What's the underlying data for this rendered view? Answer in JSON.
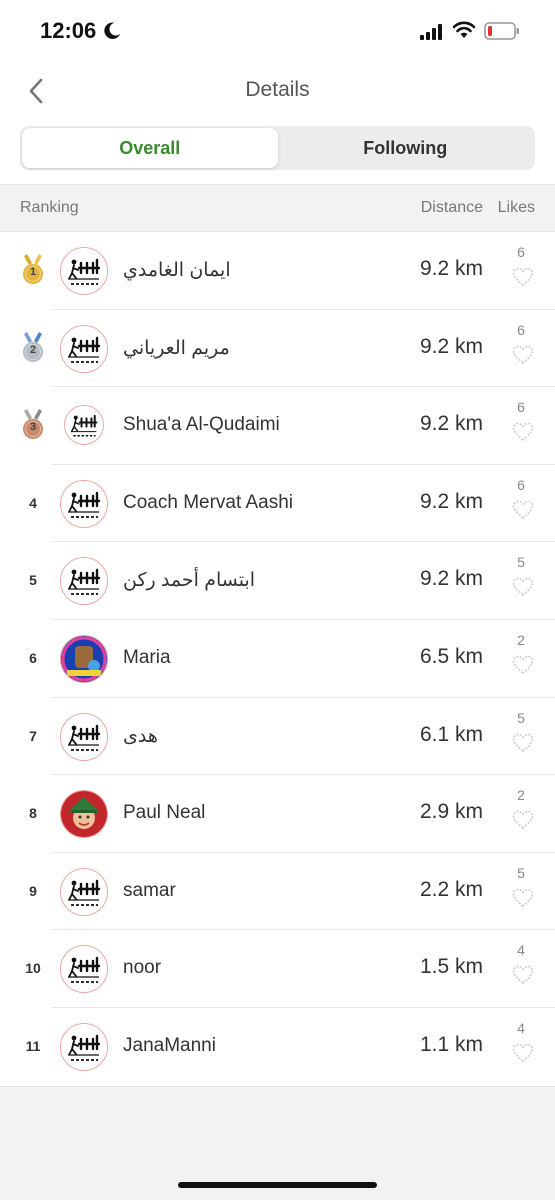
{
  "status_bar": {
    "time": "12:06"
  },
  "nav": {
    "title": "Details"
  },
  "tabs": [
    {
      "label": "Overall",
      "active": true
    },
    {
      "label": "Following",
      "active": false
    }
  ],
  "table_header": {
    "ranking": "Ranking",
    "distance": "Distance",
    "likes": "Likes"
  },
  "colors": {
    "accent_green": "#3a8a2e",
    "gold": "#e3b33a",
    "silver": "#b7bcc2",
    "bronze": "#c9896a"
  },
  "rows": [
    {
      "rank": "1",
      "medal": "gold",
      "avatar": "club-logo",
      "name": "ايمان الغامدي",
      "distance": "9.2 km",
      "likes": "6"
    },
    {
      "rank": "2",
      "medal": "silver",
      "avatar": "club-logo",
      "name": "مريم العرياني",
      "distance": "9.2 km",
      "likes": "6"
    },
    {
      "rank": "3",
      "medal": "bronze",
      "avatar": "club-logo",
      "name": "Shua'a Al-Qudaimi",
      "distance": "9.2 km",
      "likes": "6"
    },
    {
      "rank": "4",
      "avatar": "club-logo",
      "name": "Coach Mervat Aashi",
      "distance": "9.2 km",
      "likes": "6"
    },
    {
      "rank": "5",
      "avatar": "club-logo",
      "name": "ابتسام أحمد ركن",
      "distance": "9.2 km",
      "likes": "5"
    },
    {
      "rank": "6",
      "avatar": "photo-blue",
      "name": "Maria",
      "distance": "6.5 km",
      "likes": "2"
    },
    {
      "rank": "7",
      "avatar": "club-logo",
      "name": "هدى",
      "distance": "6.1 km",
      "likes": "5"
    },
    {
      "rank": "8",
      "avatar": "photo-red",
      "name": "Paul Neal",
      "distance": "2.9 km",
      "likes": "2"
    },
    {
      "rank": "9",
      "avatar": "club-logo",
      "name": "samar",
      "distance": "2.2 km",
      "likes": "5"
    },
    {
      "rank": "10",
      "avatar": "club-logo",
      "name": "noor",
      "distance": "1.5 km",
      "likes": "4"
    },
    {
      "rank": "11",
      "avatar": "club-logo",
      "name": "JanaManni",
      "distance": "1.1 km",
      "likes": "4"
    }
  ]
}
